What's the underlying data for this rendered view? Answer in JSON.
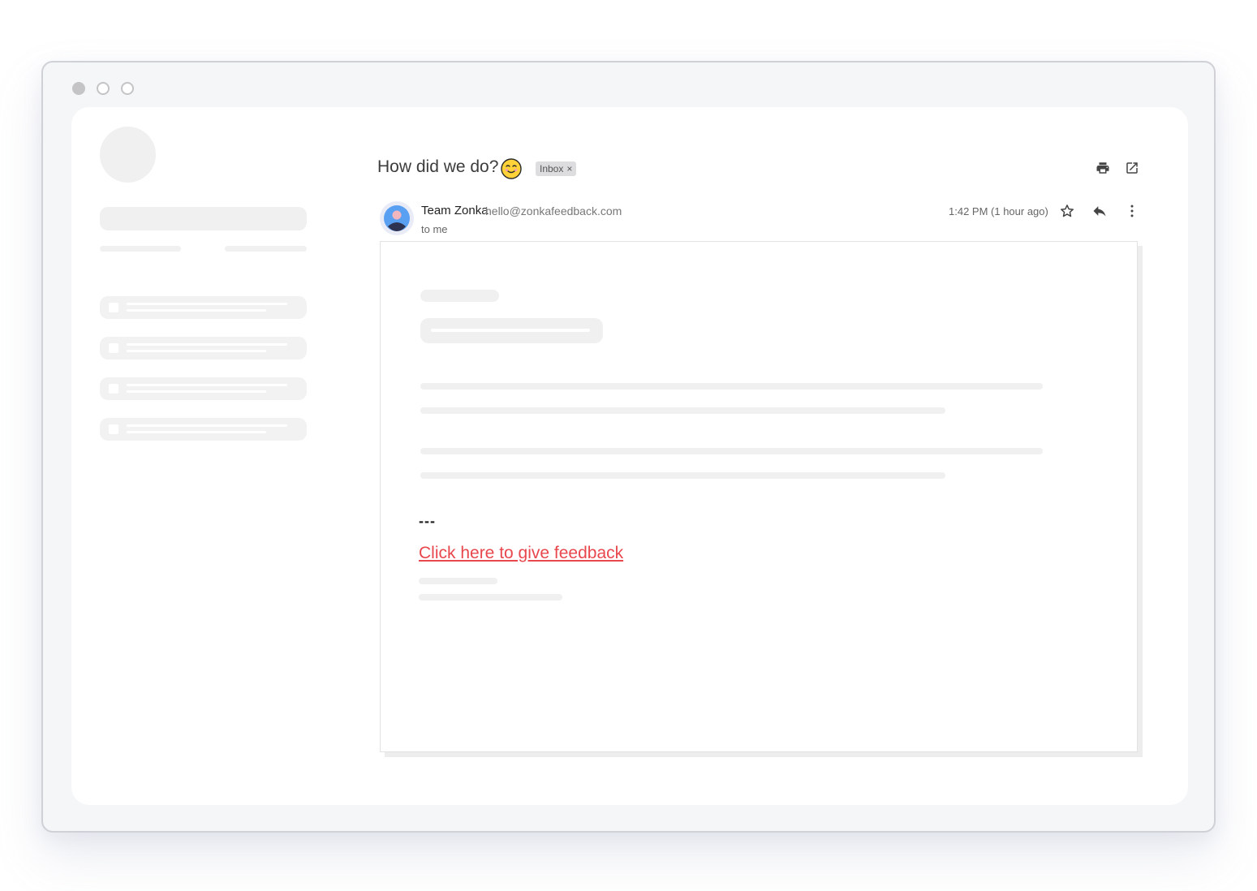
{
  "email": {
    "subject": "How did we do?",
    "label": "Inbox",
    "label_close": "×",
    "sender_name": "Team Zonka",
    "sender_email": "hello@zonkafeedback.com",
    "recipient": "to me",
    "time": "1:42 PM (1 hour ago)",
    "divider": "---",
    "link_text": "Click here to give feedback"
  },
  "colors": {
    "link": "#e8474d",
    "skeleton": "#f0f0f1"
  },
  "icons": [
    "smile-emoji-icon",
    "print-icon",
    "open-in-new-icon",
    "star-icon",
    "reply-icon",
    "more-vert-icon",
    "user-avatar-icon"
  ]
}
